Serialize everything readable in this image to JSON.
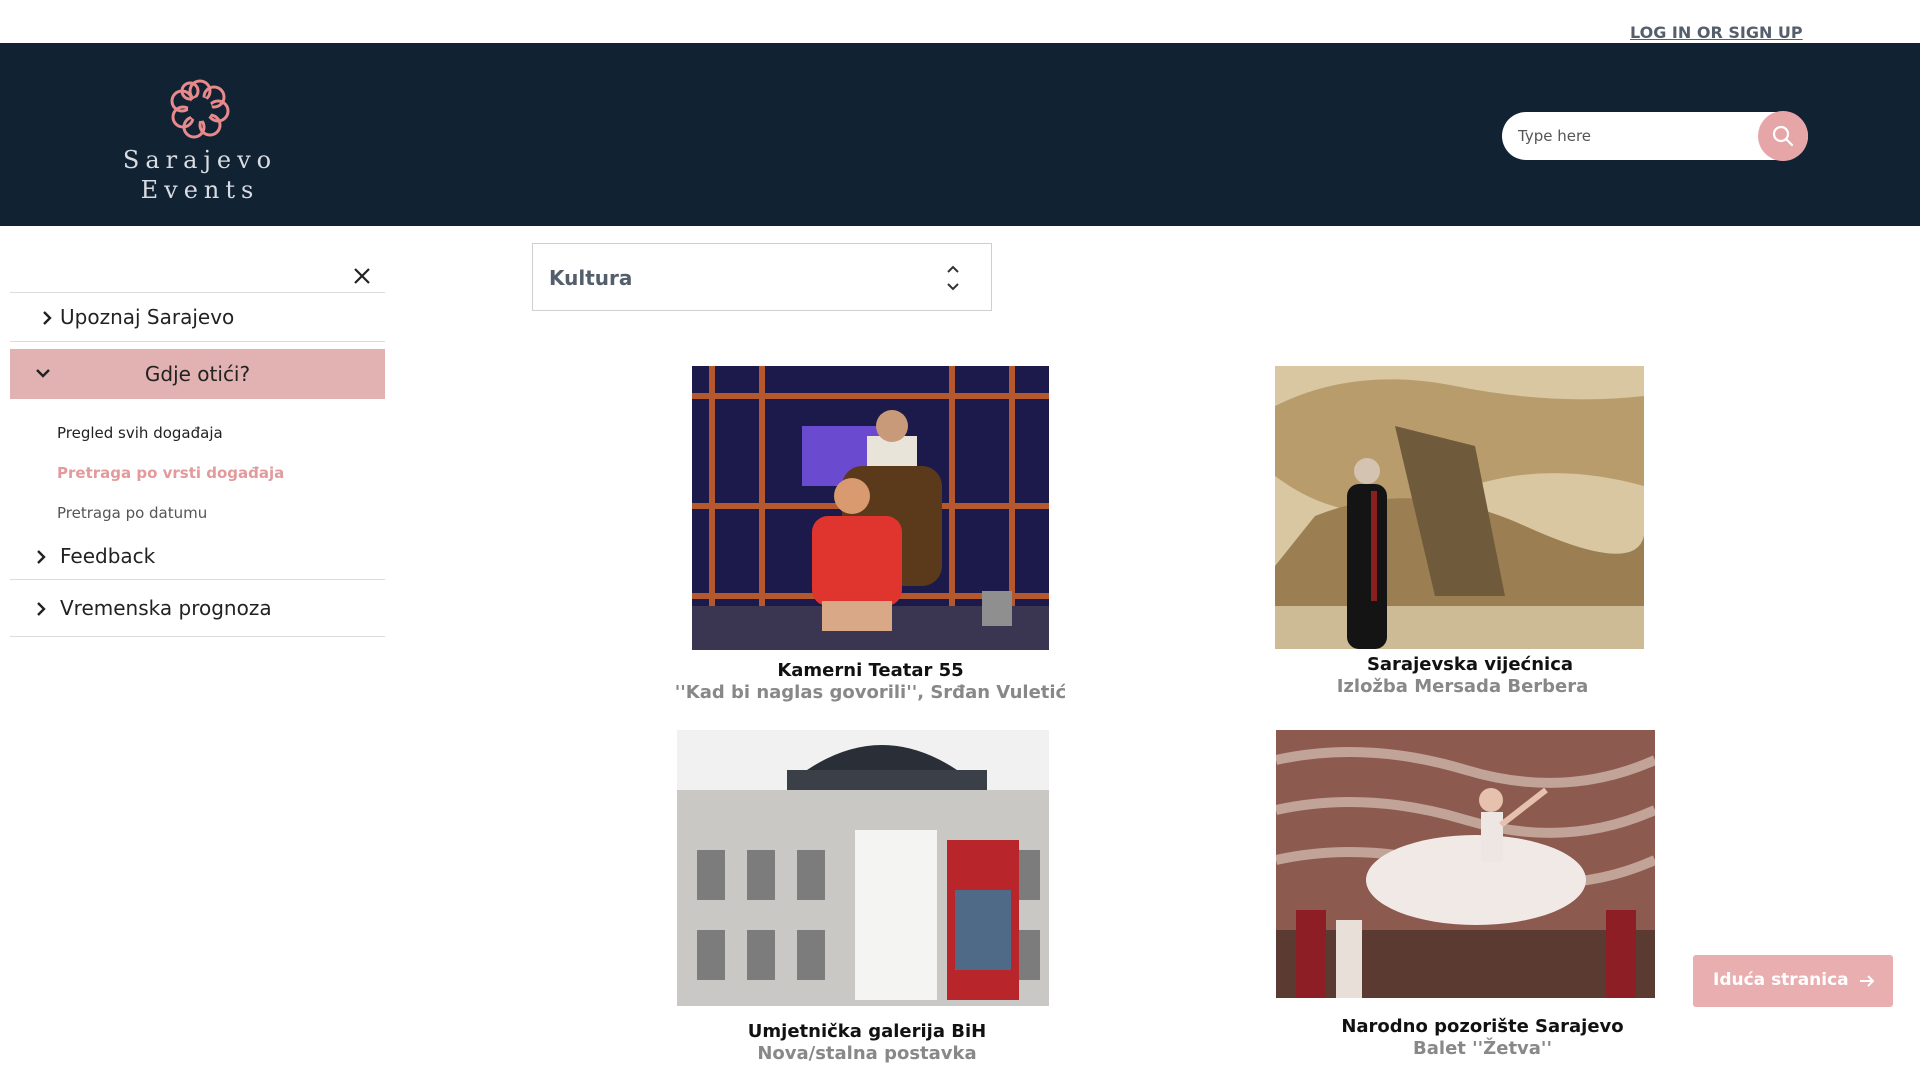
{
  "topbar": {
    "login_label": "LOG IN OR SIGN UP"
  },
  "header": {
    "logo_line1": "Sarajevo",
    "logo_line2": "Events",
    "search_placeholder": "Type here"
  },
  "sidebar": {
    "items": [
      {
        "label": "Upoznaj Sarajevo"
      },
      {
        "label": "Gdje otići?"
      },
      {
        "label": "Feedback"
      },
      {
        "label": "Vremenska prognoza"
      }
    ],
    "subitems": [
      {
        "label": "Pregled svih događaja",
        "color": "#222222"
      },
      {
        "label": "Pretraga po vrsti događaja",
        "color": "#e39a9c"
      },
      {
        "label": "Pretraga po datumu",
        "color": "#555555"
      }
    ]
  },
  "filter": {
    "selected": "Kultura"
  },
  "events": [
    {
      "title": "Kamerni Teatar 55",
      "subtitle": "''Kad bi naglas govorili'', Srđan Vuletić"
    },
    {
      "title": "Sarajevska vijećnica",
      "subtitle": "Izložba Mersada Berbera"
    },
    {
      "title": "Umjetnička galerija BiH",
      "subtitle": "Nova/stalna postavka"
    },
    {
      "title": "Narodno pozorište Sarajevo",
      "subtitle": "Balet ''Žetva''"
    }
  ],
  "pagination": {
    "next_label": "Iduća stranica"
  },
  "colors": {
    "header_bg": "#112233",
    "accent": "#e6a6a8",
    "active_item": "#e2b1b2"
  }
}
